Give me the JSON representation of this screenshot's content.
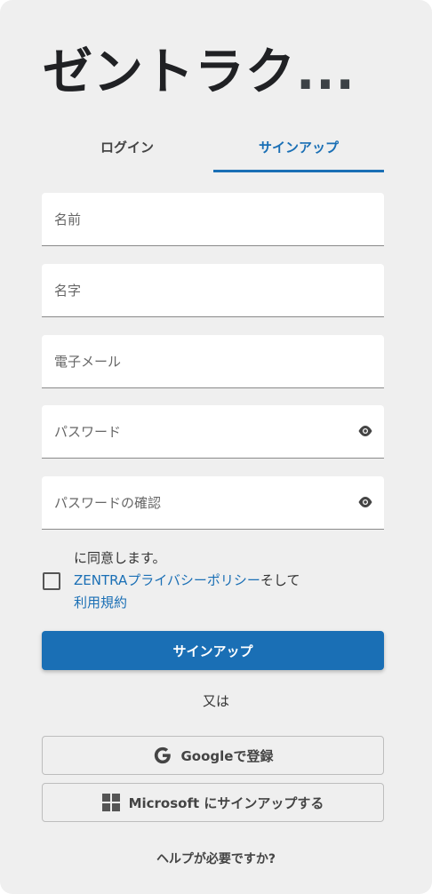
{
  "header": {
    "title": "ゼントラク",
    "title_suffix": "..."
  },
  "tabs": {
    "login": "ログイン",
    "signup": "サインアップ"
  },
  "form": {
    "first_name_placeholder": "名前",
    "last_name_placeholder": "名字",
    "email_placeholder": "電子メール",
    "password_placeholder": "パスワード",
    "confirm_password_placeholder": "パスワードの確認"
  },
  "agreement": {
    "prefix": "に同意します。",
    "brand": "ZENTRA",
    "privacy_link": "プライバシーポリシー",
    "conjunction": "そして",
    "terms_link": "利用規約"
  },
  "actions": {
    "signup_button": "サインアップ",
    "or_text": "又は",
    "google_button": "Googleで登録",
    "microsoft_button": "Microsoft にサインアップする",
    "help_link": "ヘルプが必要ですか?"
  },
  "icons": {
    "password_visibility": "eye-icon",
    "google": "google-icon",
    "microsoft": "microsoft-icon"
  },
  "colors": {
    "accent": "#1a6fb5",
    "background": "#efefef"
  }
}
